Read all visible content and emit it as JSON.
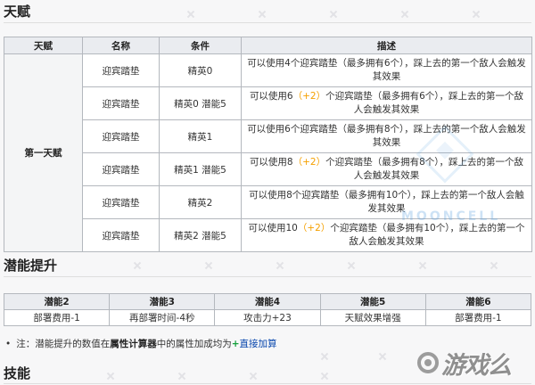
{
  "talent": {
    "heading": "天赋",
    "headers": {
      "talent": "天赋",
      "name": "名称",
      "condition": "条件",
      "description": "描述"
    },
    "group_label": "第一天赋",
    "rows": [
      {
        "name": "迎宾踏垫",
        "condition": "精英0",
        "desc_a": "可以使用4个迎宾踏垫（最多拥有6个），踩上去的第一个敌人会触发其效果"
      },
      {
        "name": "迎宾踏垫",
        "condition": "精英0 潜能5",
        "desc_a": "可以使用6",
        "bonus": "（+2）",
        "desc_b": "个迎宾踏垫（最多拥有6个），踩上去的第一个敌人会触发其效果"
      },
      {
        "name": "迎宾踏垫",
        "condition": "精英1",
        "desc_a": "可以使用6个迎宾踏垫（最多拥有8个），踩上去的第一个敌人会触发其效果"
      },
      {
        "name": "迎宾踏垫",
        "condition": "精英1 潜能5",
        "desc_a": "可以使用8",
        "bonus": "（+2）",
        "desc_b": "个迎宾踏垫（最多拥有8个），踩上去的第一个敌人会触发其效果"
      },
      {
        "name": "迎宾踏垫",
        "condition": "精英2",
        "desc_a": "可以使用8个迎宾踏垫（最多拥有10个），踩上去的第一个敌人会触发其效果"
      },
      {
        "name": "迎宾踏垫",
        "condition": "精英2 潜能5",
        "desc_a": "可以使用10",
        "bonus": "（+2）",
        "desc_b": "个迎宾踏垫（最多拥有10个），踩上去的第一个敌人会触发其效果"
      }
    ]
  },
  "potential": {
    "heading": "潜能提升",
    "headers": [
      "潜能2",
      "潜能3",
      "潜能4",
      "潜能5",
      "潜能6"
    ],
    "values": [
      "部署费用-1",
      "再部署时间-4秒",
      "攻击力+23",
      "天赋效果增强",
      "部署费用-1"
    ]
  },
  "note": {
    "bullet": "•",
    "prefix": "注：潜能提升的数值在",
    "bold": "属性计算器",
    "middle": "中的属性加成均为",
    "plus": "+",
    "link": "直接加算"
  },
  "skills": {
    "heading": "技能"
  },
  "watermarks": {
    "site_logo": "游戏么",
    "site_logo_icon": "gamepad-logo-icon",
    "wiki_mark": "MOONCELL",
    "wiki_mark_icon": "mooncell-diamond-icon"
  },
  "colors": {
    "bonus": "#f5a000",
    "plus": "#14a03c",
    "link": "#0645ad",
    "header_bg": "#eaecf0",
    "border": "#b4b8be"
  }
}
